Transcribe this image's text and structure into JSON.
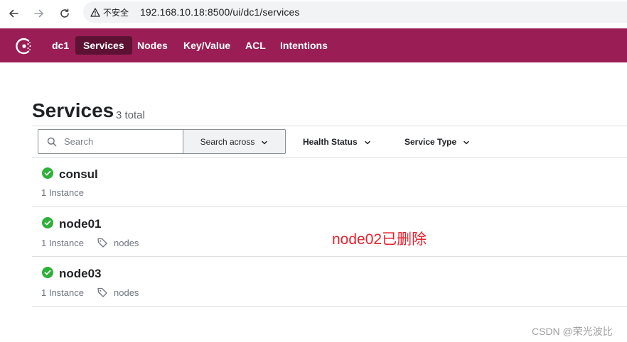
{
  "browser": {
    "security_label": "不安全",
    "url": "192.168.10.18:8500/ui/dc1/services"
  },
  "topnav": {
    "datacenter": "dc1",
    "items": [
      {
        "label": "Services",
        "active": true
      },
      {
        "label": "Nodes",
        "active": false
      },
      {
        "label": "Key/Value",
        "active": false
      },
      {
        "label": "ACL",
        "active": false
      },
      {
        "label": "Intentions",
        "active": false
      }
    ]
  },
  "page": {
    "title": "Services",
    "count": "3 total"
  },
  "filters": {
    "search_placeholder": "Search",
    "search_across": "Search across",
    "health_status": "Health Status",
    "service_type": "Service Type"
  },
  "services": [
    {
      "name": "consul",
      "instances": "1 Instance",
      "tag": "",
      "status": "passing"
    },
    {
      "name": "node01",
      "instances": "1 Instance",
      "tag": "nodes",
      "status": "passing"
    },
    {
      "name": "node03",
      "instances": "1 Instance",
      "tag": "nodes",
      "status": "passing"
    }
  ],
  "annotation": "node02已删除",
  "watermark": "CSDN @荣光波比",
  "colors": {
    "brand": "#9a1e55",
    "brand_active": "#5d1233",
    "passing": "#2eb039",
    "annotation": "#e8232e"
  }
}
